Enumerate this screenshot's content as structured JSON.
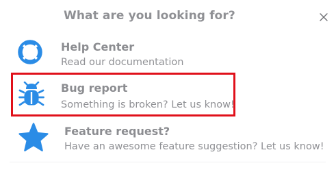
{
  "dialog": {
    "title": "What are you looking for?",
    "close_icon": "close-icon"
  },
  "options": [
    {
      "title": "Help Center",
      "description": "Read our documentation",
      "icon": "lifebuoy-icon"
    },
    {
      "title": "Bug report",
      "description": "Something is broken? Let us know!",
      "icon": "bug-icon",
      "highlighted": true
    },
    {
      "title": "Feature request?",
      "description": "Have an awesome feature suggestion? Let us know!",
      "icon": "star-icon"
    }
  ],
  "colors": {
    "icon_blue": "#2b8ce6",
    "highlight_border": "#e0101a",
    "text_gray": "#8c8d91"
  }
}
